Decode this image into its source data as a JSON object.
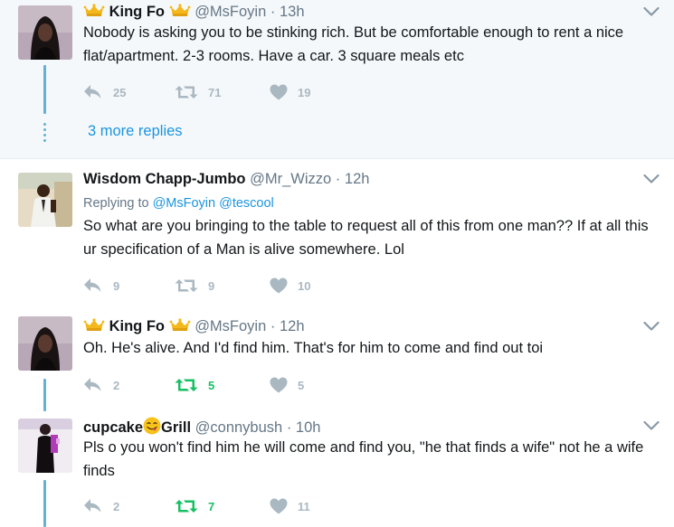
{
  "tweets": [
    {
      "name": "King Fo",
      "handle": "@MsFoyin",
      "time": "13h",
      "replying_label": "",
      "replying_to": "",
      "text": "Nobody is asking you to be stinking rich. But be comfortable enough to rent a nice flat/apartment. 2-3 rooms. Have a car. 3 square meals etc",
      "replies": "25",
      "retweets": "71",
      "likes": "19"
    },
    {
      "name": "Wisdom Chapp-Jumbo",
      "handle": "@Mr_Wizzo",
      "time": "12h",
      "replying_label": "Replying to",
      "replying_to": "@MsFoyin @tescool",
      "text": "So what are you bringing to the table to request all of this from one man?? If at all this ur specification of a Man is alive somewhere. Lol",
      "replies": "9",
      "retweets": "9",
      "likes": "10"
    },
    {
      "name": "King Fo",
      "handle": "@MsFoyin",
      "time": "12h",
      "replying_label": "",
      "replying_to": "",
      "text": "Oh. He's alive. And I'd find him. That's for him to come and find out toi",
      "replies": "2",
      "retweets": "5",
      "likes": "5"
    },
    {
      "name_part1": "cupcake",
      "name_part2": "Grill",
      "handle": "@connybush",
      "time": "10h",
      "replying_label": "",
      "replying_to": "",
      "text": "Pls o you won't find him he will come and find you, \"he that finds a wife\" not he a wife finds",
      "replies": "2",
      "retweets": "7",
      "likes": "11"
    }
  ],
  "more_replies": "3 more replies",
  "separator": "·",
  "icons": {
    "reply": "reply-icon",
    "retweet": "retweet-icon",
    "like": "heart-icon",
    "caret": "chevron-down-icon",
    "crown": "crown-emoji-icon",
    "emoji": "face-savoring-food-emoji-icon"
  },
  "colors": {
    "link": "#1b95e0",
    "thread": "#65b1d3",
    "muted": "#657786",
    "action": "#aab8c2",
    "retweeted": "#17bf63",
    "highlight_bg": "#f5f8fa"
  }
}
